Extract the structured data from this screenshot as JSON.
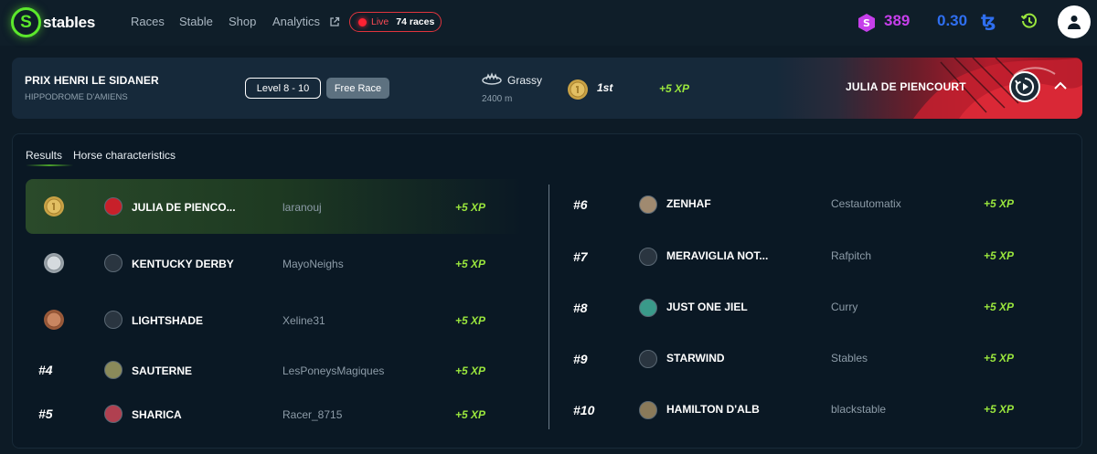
{
  "nav": {
    "logo_text": "stables",
    "links": [
      "Races",
      "Stable",
      "Shop",
      "Analytics"
    ],
    "live_label": "Live",
    "live_count": "74 races",
    "gem_balance": "389",
    "tez_balance": "0.30",
    "tez_symbol": "ꜩ"
  },
  "race": {
    "title": "PRIX HENRI LE SIDANER",
    "venue": "HIPPODROME D'AMIENS",
    "level": "Level 8 - 10",
    "type": "Free Race",
    "surface": "Grassy",
    "distance": "2400 m",
    "place": "1st",
    "xp": "+5 XP",
    "winner": "JULIA DE PIENCOURT"
  },
  "tabs": [
    "Results",
    "Horse characteristics"
  ],
  "results_left": [
    {
      "rank": "",
      "medal": "gold",
      "horse": "JULIA DE PIENCO...",
      "owner": "laranouj",
      "xp": "+5 XP",
      "avatar_color": "#c8202a"
    },
    {
      "rank": "",
      "medal": "silver",
      "horse": "KENTUCKY DERBY",
      "owner": "MayoNeighs",
      "xp": "+5 XP",
      "avatar_color": "#5a6470"
    },
    {
      "rank": "",
      "medal": "bronze",
      "horse": "LIGHTSHADE",
      "owner": "Xeline31",
      "xp": "+5 XP",
      "avatar_color": "#5a6470"
    },
    {
      "rank": "#4",
      "medal": "",
      "horse": "SAUTERNE",
      "owner": "LesPoneysMagiques",
      "xp": "+5 XP",
      "avatar_color": "#8a8a5a"
    },
    {
      "rank": "#5",
      "medal": "",
      "horse": "SHARICA",
      "owner": "Racer_8715",
      "xp": "+5 XP",
      "avatar_color": "#b04050"
    }
  ],
  "results_right": [
    {
      "rank": "#6",
      "horse": "ZENHAF",
      "owner": "Cestautomatix",
      "xp": "+5 XP",
      "avatar_color": "#a08a70"
    },
    {
      "rank": "#7",
      "horse": "MERAVIGLIA NOT...",
      "owner": "Rafpitch",
      "xp": "+5 XP",
      "avatar_color": "#5a6470"
    },
    {
      "rank": "#8",
      "horse": "JUST ONE JIEL",
      "owner": "Curry",
      "xp": "+5 XP",
      "avatar_color": "#3a9a8a"
    },
    {
      "rank": "#9",
      "horse": "STARWIND",
      "owner": "Stables",
      "xp": "+5 XP",
      "avatar_color": "#5a6470"
    },
    {
      "rank": "#10",
      "horse": "HAMILTON D'ALB",
      "owner": "blackstable",
      "xp": "+5 XP",
      "avatar_color": "#8a7a5a"
    }
  ],
  "colors": {
    "accent_green": "#5ce82c",
    "xp_green": "#9ae63d",
    "live_red": "#e0343d",
    "gem_purple": "#c63fea",
    "tez_blue": "#2f6ff0"
  }
}
